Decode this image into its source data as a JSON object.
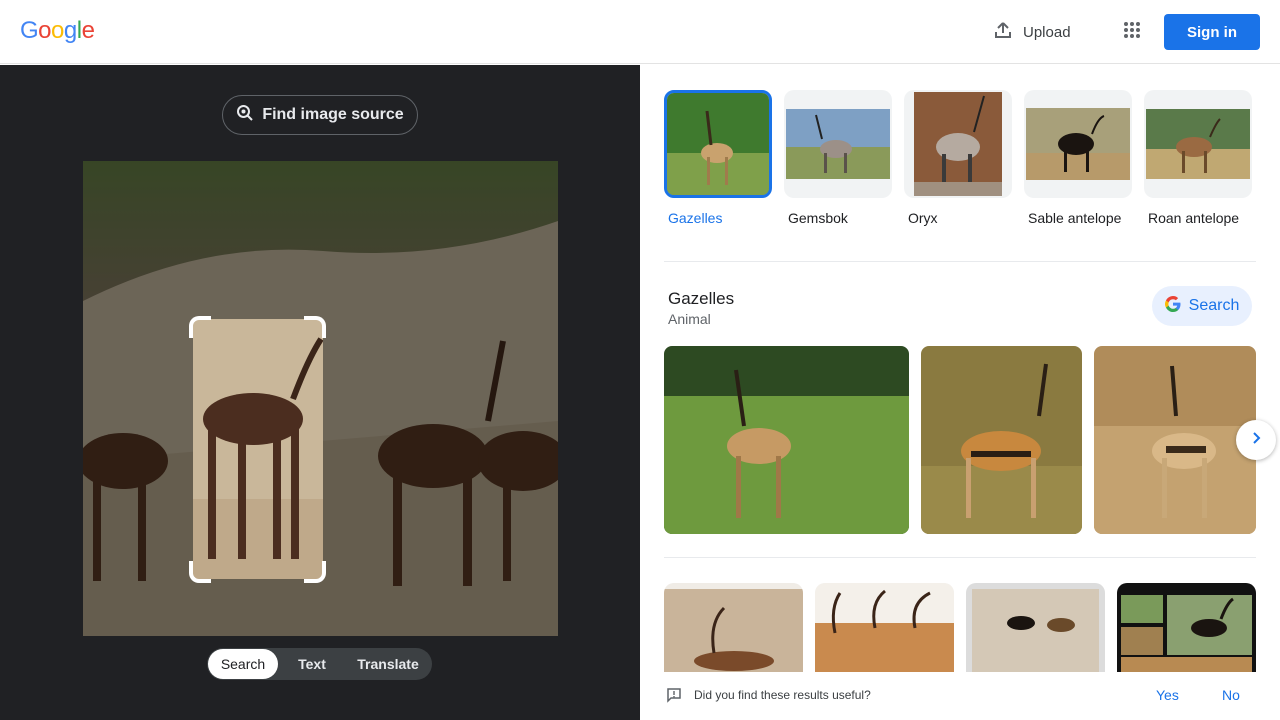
{
  "header": {
    "logo_letters": [
      "G",
      "o",
      "o",
      "g",
      "l",
      "e"
    ],
    "upload_label": "Upload",
    "signin_label": "Sign in"
  },
  "lens": {
    "find_source_label": "Find image source",
    "tabs": [
      {
        "label": "Search",
        "active": true
      },
      {
        "label": "Text",
        "active": false
      },
      {
        "label": "Translate",
        "active": false
      }
    ]
  },
  "chips": [
    {
      "label": "Gazelles",
      "active": true
    },
    {
      "label": "Gemsbok",
      "active": false
    },
    {
      "label": "Oryx",
      "active": false
    },
    {
      "label": "Sable antelope",
      "active": false
    },
    {
      "label": "Roan antelope",
      "active": false
    }
  ],
  "entity": {
    "title": "Gazelles",
    "subtitle": "Animal",
    "search_label": "Search"
  },
  "feedback": {
    "question": "Did you find these results useful?",
    "yes": "Yes",
    "no": "No"
  },
  "colors": {
    "accent": "#1a73e8",
    "dark_panel": "#202124",
    "logo": [
      "#4285f4",
      "#ea4335",
      "#fbbc05",
      "#4285f4",
      "#34a853",
      "#ea4335"
    ]
  }
}
